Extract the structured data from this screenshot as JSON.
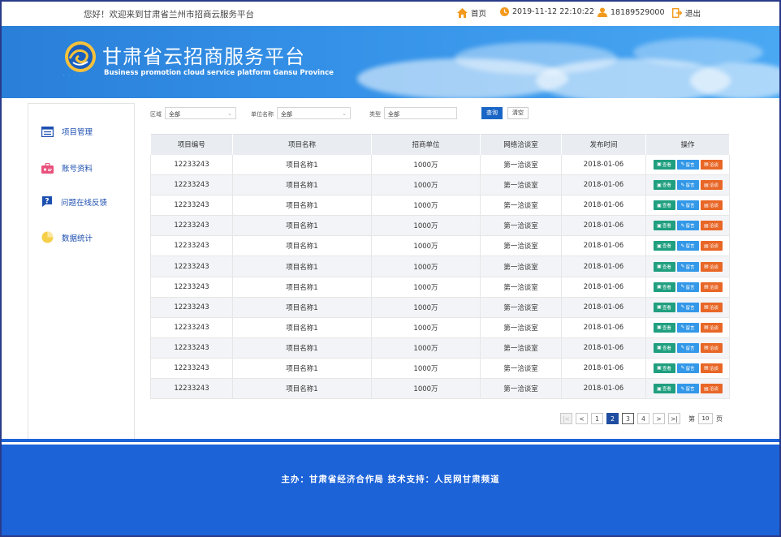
{
  "topbar": {
    "welcome": "您好！欢迎来到甘肃省兰州市招商云服务平台",
    "home_label": "首页",
    "datetime": "2019-11-12 22:10:22",
    "phone": "18189529000",
    "logout_label": "退出"
  },
  "banner": {
    "title": "甘肃省云招商服务平台",
    "subtitle": "Business promotion cloud service platform  Gansu Province"
  },
  "sidebar": {
    "items": [
      {
        "label": "项目管理"
      },
      {
        "label": "账号资料"
      },
      {
        "label": "问题在线反馈"
      },
      {
        "label": "数据统计"
      }
    ]
  },
  "filters": {
    "region_label": "区域",
    "region_value": "全部",
    "unit_label": "单位名称",
    "unit_value": "全部",
    "type_label": "类型",
    "type_value": "全部",
    "query_label": "查询",
    "clear_label": "清空"
  },
  "table": {
    "headers": [
      "项目编号",
      "项目名称",
      "招商单位",
      "网络洽谈室",
      "发布时间",
      "操作"
    ],
    "rows": [
      {
        "id": "12233243",
        "name": "项目名称1",
        "unit": "1000万",
        "room": "第一洽谈室",
        "date": "2018-01-06",
        "talk": "洽谈"
      },
      {
        "id": "12233243",
        "name": "项目名称1",
        "unit": "1000万",
        "room": "第一洽谈室",
        "date": "2018-01-06",
        "talk": "洽谈"
      },
      {
        "id": "12233243",
        "name": "项目名称1",
        "unit": "1000万",
        "room": "第一洽谈室",
        "date": "2018-01-06",
        "talk": "洽谈"
      },
      {
        "id": "12233243",
        "name": "项目名称1",
        "unit": "1000万",
        "room": "第一洽谈室",
        "date": "2018-01-06",
        "talk": "洽谈"
      },
      {
        "id": "12233243",
        "name": "项目名称1",
        "unit": "1000万",
        "room": "第一洽谈室",
        "date": "2018-01-06",
        "talk": "洽谈"
      },
      {
        "id": "12233243",
        "name": "项目名称1",
        "unit": "1000万",
        "room": "第一洽谈室",
        "date": "2018-01-06",
        "talk": "洽谈"
      },
      {
        "id": "12233243",
        "name": "项目名称1",
        "unit": "1000万",
        "room": "第一洽谈室",
        "date": "2018-01-06",
        "talk": "洽谈"
      },
      {
        "id": "12233243",
        "name": "项目名称1",
        "unit": "1000万",
        "room": "第一洽谈室",
        "date": "2018-01-06",
        "talk": "洽谈"
      },
      {
        "id": "12233243",
        "name": "项目名称1",
        "unit": "1000万",
        "room": "第一洽谈室",
        "date": "2018-01-06",
        "talk": "洽谈"
      },
      {
        "id": "12233243",
        "name": "项目名称1",
        "unit": "1000万",
        "room": "第一洽谈室",
        "date": "2018-01-06",
        "talk": "洽谈"
      },
      {
        "id": "12233243",
        "name": "项目名称1",
        "unit": "1000万",
        "room": "第一洽谈室",
        "date": "2018-01-06",
        "talk": "洽谈"
      },
      {
        "id": "12233243",
        "name": "项目名称1",
        "unit": "1000万",
        "room": "第一洽谈室",
        "date": "2018-01-06",
        "talk": "洽谈"
      }
    ],
    "view_label": "查看",
    "msg_label": "留言"
  },
  "pagination": {
    "first": "|<",
    "prev": "<",
    "pages": [
      "1",
      "2",
      "3",
      "4"
    ],
    "current_page": "2",
    "next": ">",
    "last": ">|",
    "jump_prefix": "第",
    "jump_value": "10",
    "jump_suffix": "页"
  },
  "footer": {
    "text": "主办：甘肃省经济合作局    技术支持：人民网甘肃频道"
  },
  "colors": {
    "primary_blue": "#1c63d8",
    "view_green": "#1f9f7f",
    "msg_blue": "#3398e8",
    "talk_orange": "#e86626",
    "nav_text": "#1d4fb0"
  }
}
